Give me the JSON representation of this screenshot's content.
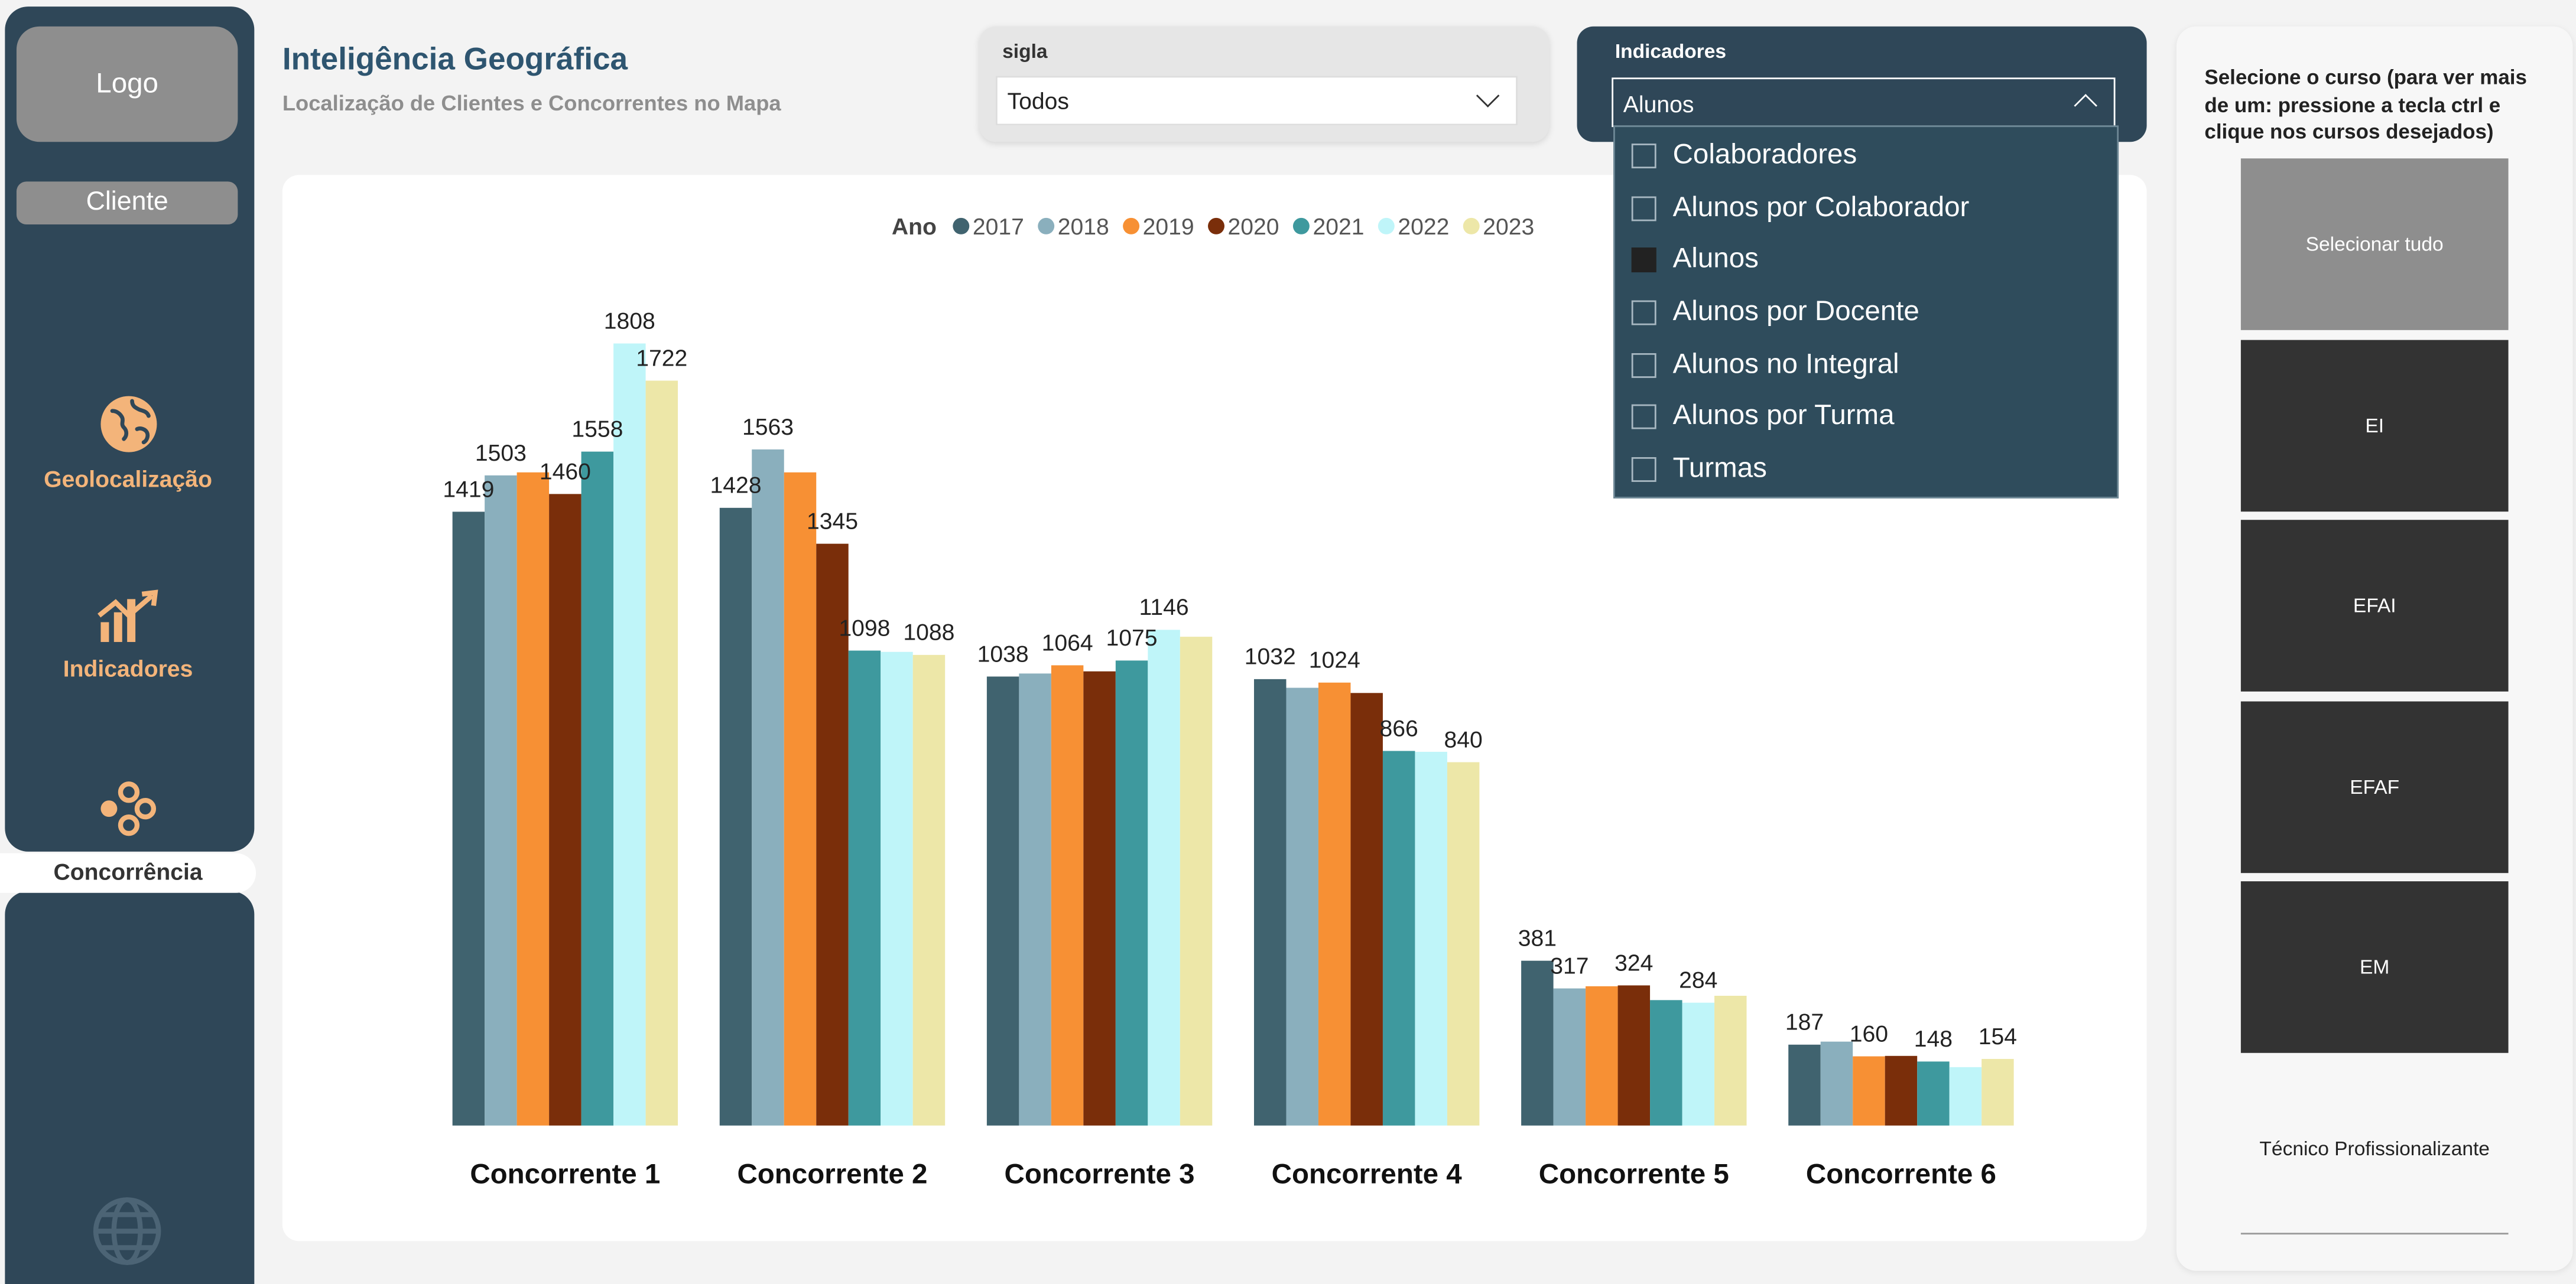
{
  "sidebar": {
    "logo": "Logo",
    "cliente": "Cliente",
    "nav": [
      {
        "label": "Geolocalização",
        "icon": "globe-icon"
      },
      {
        "label": "Indicadores",
        "icon": "trend-chart-icon"
      },
      {
        "label": "Concorrência",
        "icon": "network-icon"
      }
    ],
    "bottom_icon": "world-icon"
  },
  "header": {
    "title": "Inteligência Geográfica",
    "subtitle": "Localização de Clientes e Concorrentes no Mapa"
  },
  "sigla": {
    "label": "sigla",
    "value": "Todos"
  },
  "indicadores": {
    "label": "Indicadores",
    "value": "Alunos",
    "options": [
      {
        "label": "Colaboradores",
        "checked": false
      },
      {
        "label": "Alunos por Colaborador",
        "checked": false
      },
      {
        "label": "Alunos",
        "checked": true
      },
      {
        "label": "Alunos por Docente",
        "checked": false
      },
      {
        "label": "Alunos no Integral",
        "checked": false
      },
      {
        "label": "Alunos por Turma",
        "checked": false
      },
      {
        "label": "Turmas",
        "checked": false
      }
    ]
  },
  "course_panel": {
    "hint": "Selecione o curso (para ver mais de um: pressione a tecla ctrl e clique nos cursos desejados)",
    "tiles": [
      "Selecionar tudo",
      "EI",
      "EFAI",
      "EFAF",
      "EM",
      "Técnico Profissionalizante"
    ]
  },
  "colors": {
    "sidebar": "#2f4758",
    "dropdown": "#2f4c5c",
    "accent_icon": "#f3b47a"
  },
  "chart_data": {
    "type": "bar",
    "legend_title": "Ano",
    "legend_position": "top-center",
    "categories": [
      "Concorrente 1",
      "Concorrente 2",
      "Concorrente 3",
      "Concorrente 4",
      "Concorrente 5",
      "Concorrente 6"
    ],
    "series": [
      {
        "name": "2017",
        "color": "#40636f",
        "values": [
          1419,
          1428,
          1038,
          1032,
          381,
          187
        ]
      },
      {
        "name": "2018",
        "color": "#8aafbd",
        "values": [
          1503,
          1563,
          1045,
          1012,
          317,
          194
        ]
      },
      {
        "name": "2019",
        "color": "#f79034",
        "values": [
          1510,
          1510,
          1064,
          1024,
          322,
          160
        ]
      },
      {
        "name": "2020",
        "color": "#7a2e0a",
        "values": [
          1460,
          1345,
          1050,
          1000,
          324,
          161
        ]
      },
      {
        "name": "2021",
        "color": "#3e999e",
        "values": [
          1558,
          1098,
          1075,
          866,
          290,
          148
        ]
      },
      {
        "name": "2022",
        "color": "#bff5f9",
        "values": [
          1808,
          1095,
          1146,
          864,
          284,
          135
        ]
      },
      {
        "name": "2023",
        "color": "#ede7a8",
        "values": [
          1722,
          1088,
          1130,
          840,
          300,
          154
        ]
      }
    ],
    "data_labels": [
      {
        "cat": 0,
        "series": 0,
        "text": "1419"
      },
      {
        "cat": 0,
        "series": 1,
        "text": "1503"
      },
      {
        "cat": 0,
        "series": 3,
        "text": "1460"
      },
      {
        "cat": 0,
        "series": 4,
        "text": "1558"
      },
      {
        "cat": 0,
        "series": 5,
        "text": "1808"
      },
      {
        "cat": 0,
        "series": 6,
        "text": "1722"
      },
      {
        "cat": 1,
        "series": 0,
        "text": "1428"
      },
      {
        "cat": 1,
        "series": 1,
        "text": "1563"
      },
      {
        "cat": 1,
        "series": 3,
        "text": "1345"
      },
      {
        "cat": 1,
        "series": 4,
        "text": "1098"
      },
      {
        "cat": 1,
        "series": 6,
        "text": "1088"
      },
      {
        "cat": 2,
        "series": 0,
        "text": "1038"
      },
      {
        "cat": 2,
        "series": 2,
        "text": "1064"
      },
      {
        "cat": 2,
        "series": 4,
        "text": "1075"
      },
      {
        "cat": 2,
        "series": 5,
        "text": "1146"
      },
      {
        "cat": 3,
        "series": 0,
        "text": "1032"
      },
      {
        "cat": 3,
        "series": 2,
        "text": "1024"
      },
      {
        "cat": 3,
        "series": 4,
        "text": "866"
      },
      {
        "cat": 3,
        "series": 6,
        "text": "840"
      },
      {
        "cat": 4,
        "series": 0,
        "text": "381"
      },
      {
        "cat": 4,
        "series": 1,
        "text": "317"
      },
      {
        "cat": 4,
        "series": 3,
        "text": "324"
      },
      {
        "cat": 4,
        "series": 5,
        "text": "284"
      },
      {
        "cat": 5,
        "series": 0,
        "text": "187"
      },
      {
        "cat": 5,
        "series": 2,
        "text": "160"
      },
      {
        "cat": 5,
        "series": 4,
        "text": "148"
      },
      {
        "cat": 5,
        "series": 6,
        "text": "154"
      }
    ],
    "ylim": [
      0,
      1900
    ],
    "grid": false
  }
}
